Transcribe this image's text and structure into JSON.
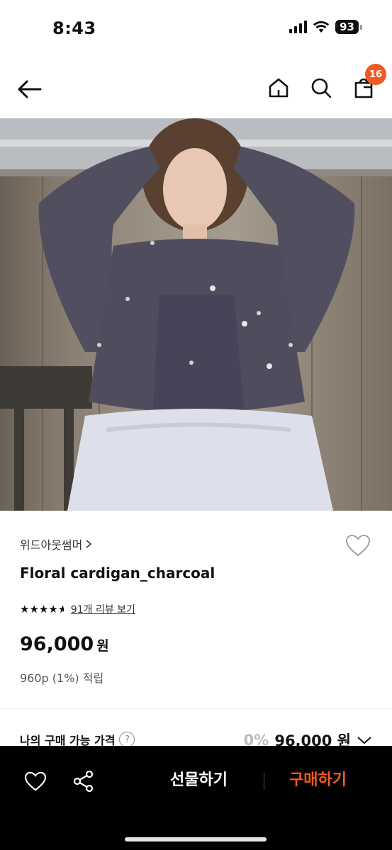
{
  "status_bar": {
    "time": "8:43",
    "battery": "93"
  },
  "nav": {
    "cart_count": "16"
  },
  "product": {
    "brand": "위드아웃썸머",
    "name": "Floral cardigan_charcoal",
    "rating": 4.5,
    "review_link": "91개 리뷰 보기",
    "price": "96,000",
    "price_unit": "원",
    "points": "960p (1%) 적립"
  },
  "availability": {
    "label": "나의 구매 가능 가격",
    "discount": "0%",
    "price": "96,000 원"
  },
  "bottom_bar": {
    "gift_label": "선물하기",
    "buy_label": "구매하기"
  },
  "colors": {
    "accent": "#f15a22",
    "bar_bg": "#000000"
  }
}
